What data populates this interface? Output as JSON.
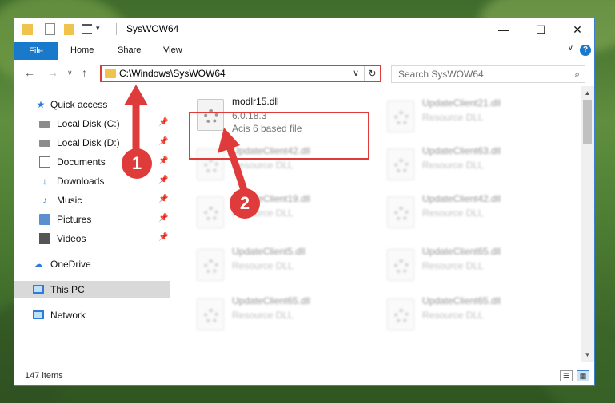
{
  "window": {
    "title": "SysWOW64"
  },
  "titlebar": {
    "minimize_glyph": "—",
    "maximize_glyph": "☐",
    "close_glyph": "✕"
  },
  "ribbon": {
    "file_label": "File",
    "tabs": [
      "Home",
      "Share",
      "View"
    ],
    "help_glyph": "?"
  },
  "nav": {
    "address_path": "C:\\Windows\\SysWOW64",
    "search_placeholder": "Search SysWOW64"
  },
  "sidebar": {
    "items": [
      {
        "label": "Quick access",
        "icon": "star-icon",
        "pinned": false
      },
      {
        "label": "Local Disk (C:)",
        "icon": "drive-icon",
        "pinned": true
      },
      {
        "label": "Local Disk (D:)",
        "icon": "drive-icon",
        "pinned": true
      },
      {
        "label": "Documents",
        "icon": "documents-icon",
        "pinned": true
      },
      {
        "label": "Downloads",
        "icon": "download-icon",
        "pinned": true
      },
      {
        "label": "Music",
        "icon": "music-icon",
        "pinned": true
      },
      {
        "label": "Pictures",
        "icon": "pictures-icon",
        "pinned": true
      },
      {
        "label": "Videos",
        "icon": "videos-icon",
        "pinned": true
      },
      {
        "label": "OneDrive",
        "icon": "cloud-icon",
        "pinned": false
      },
      {
        "label": "This PC",
        "icon": "computer-icon",
        "pinned": false
      },
      {
        "label": "Network",
        "icon": "network-icon",
        "pinned": false
      }
    ]
  },
  "files": {
    "highlighted": {
      "name": "modlr15.dll",
      "version": "6.0.18.3",
      "description": "Acis 6 based file"
    },
    "others": [
      {
        "name": "UpdateClient21.dll",
        "type": "Resource DLL"
      },
      {
        "name": "UpdateClient42.dll",
        "type": "Resource DLL"
      },
      {
        "name": "UpdateClient63.dll",
        "type": "Resource DLL"
      },
      {
        "name": "UpdateClient19.dll",
        "type": "Resource DLL"
      },
      {
        "name": "UpdateClient42.dll",
        "type": "Resource DLL"
      },
      {
        "name": "UpdateClient5.dll",
        "type": "Resource DLL"
      },
      {
        "name": "UpdateClient65.dll",
        "type": "Resource DLL"
      },
      {
        "name": "UpdateClient65.dll",
        "type": "Resource DLL"
      },
      {
        "name": "UpdateClient65.dll",
        "type": "Resource DLL"
      }
    ]
  },
  "status": {
    "item_count": "147 items"
  },
  "callouts": {
    "one": "1",
    "two": "2"
  },
  "colors": {
    "accent": "#1979ca",
    "highlight": "#e03b3b"
  }
}
